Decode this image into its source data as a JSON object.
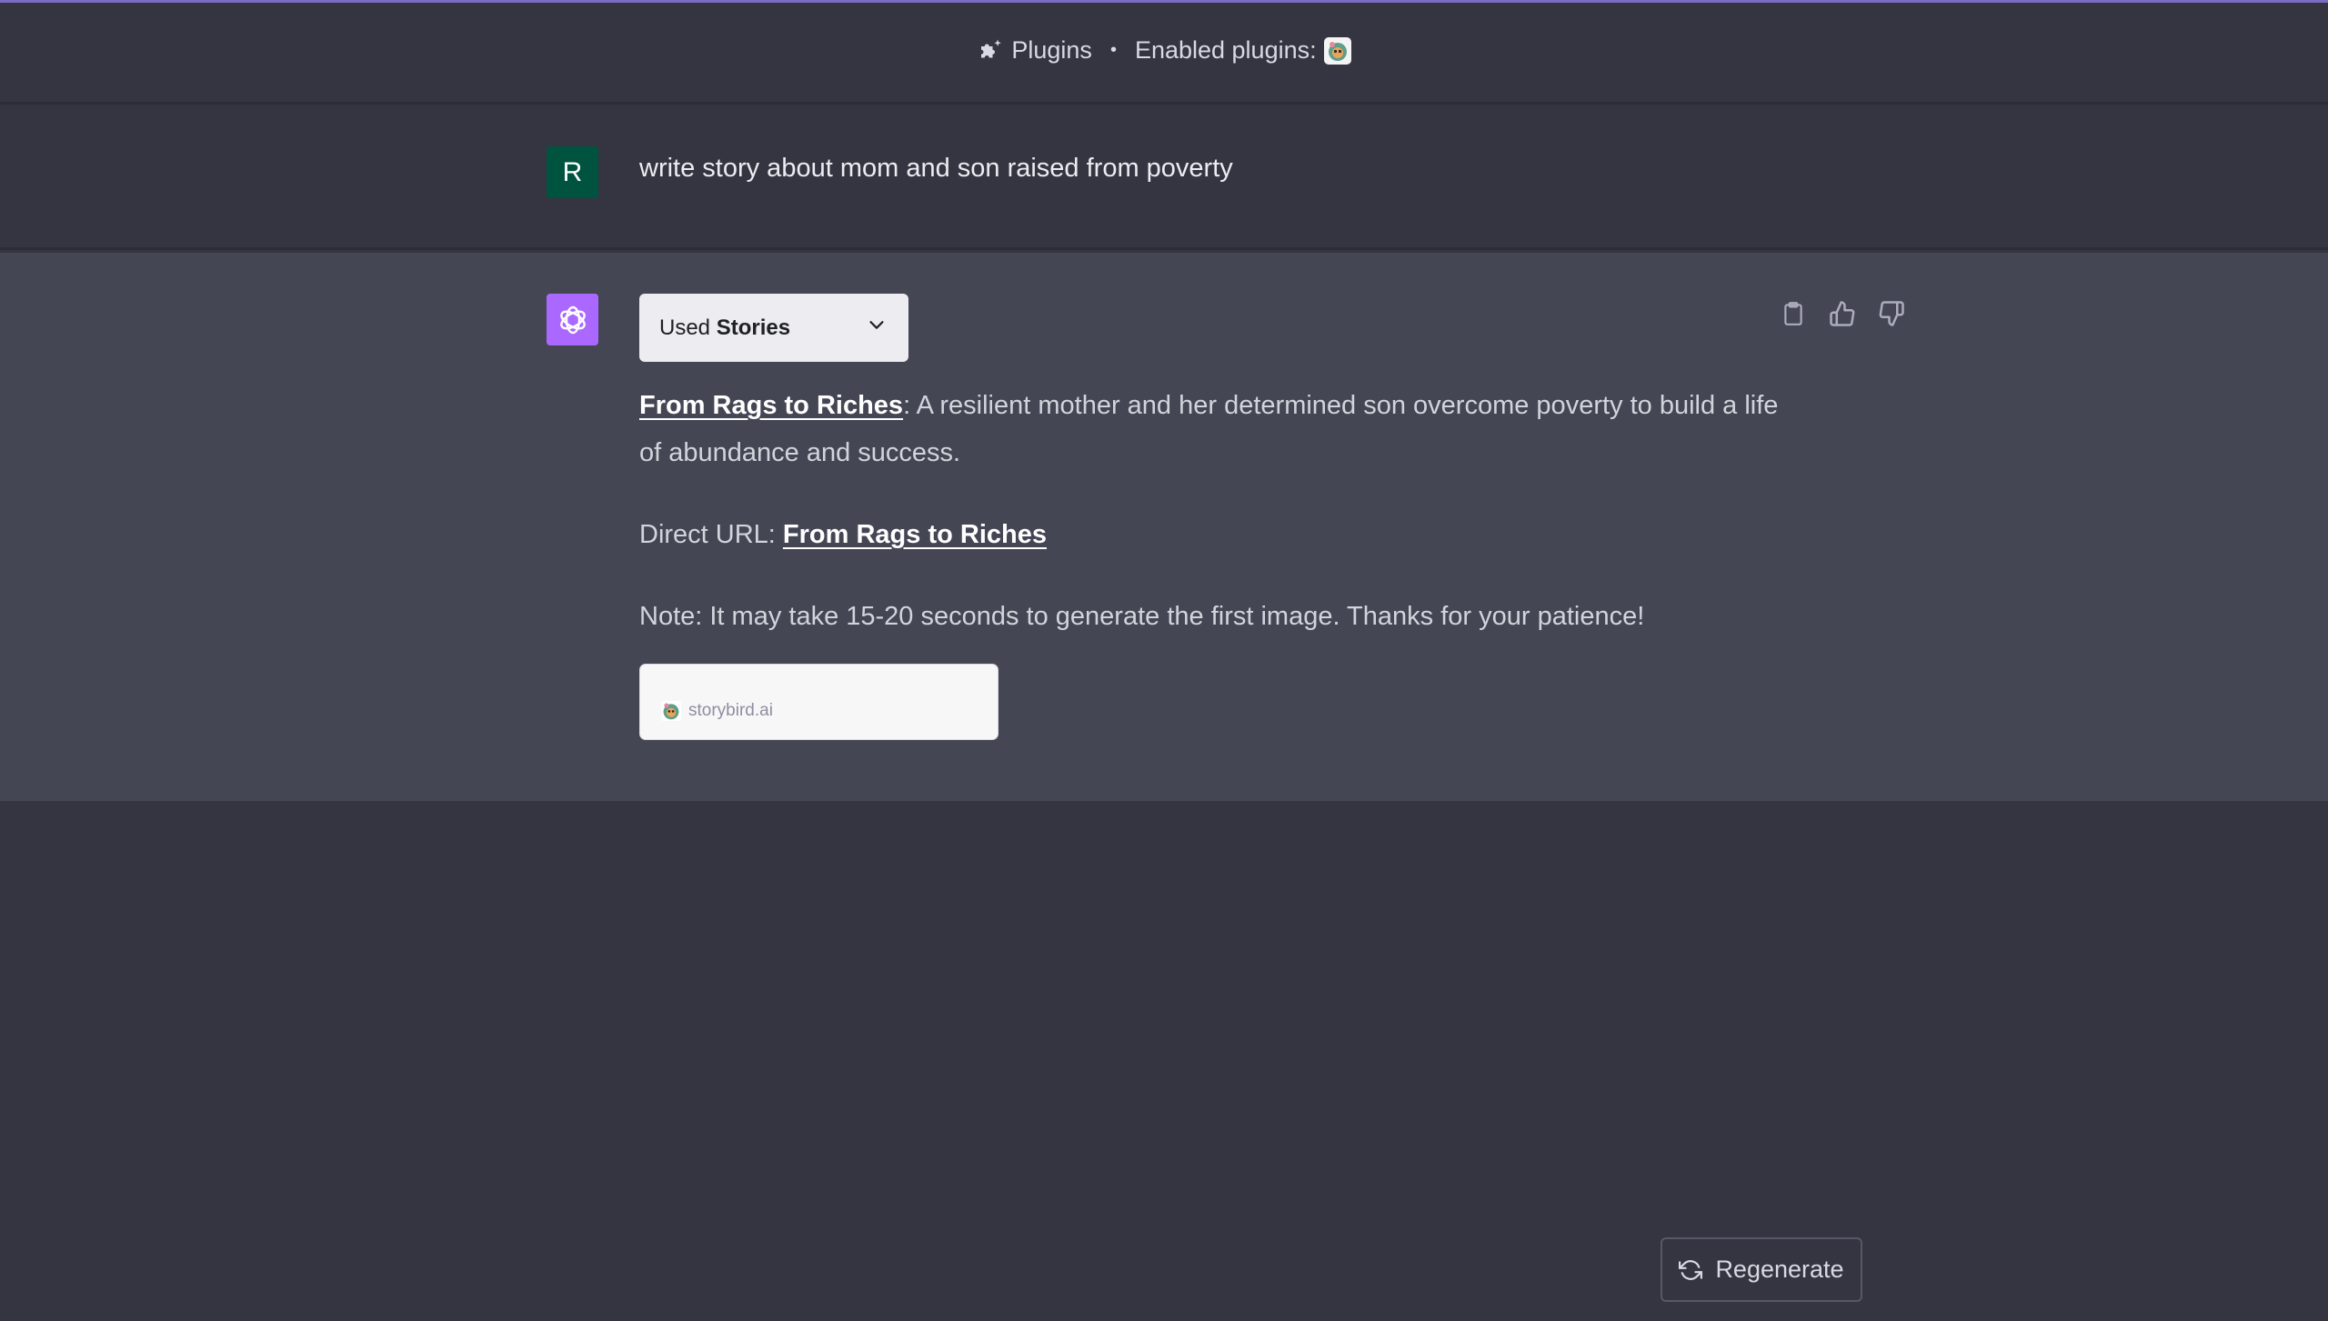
{
  "header": {
    "plugins_label": "Plugins",
    "separator": "•",
    "enabled_label": "Enabled plugins:",
    "enabled_plugins": [
      {
        "name": "Stories",
        "icon": "storybird-owl-icon"
      }
    ]
  },
  "conversation": {
    "user_message": {
      "avatar_letter": "R",
      "avatar_color": "#00543f",
      "text": "write story about mom and son raised from poverty"
    },
    "assistant_message": {
      "avatar_color": "#ab68ff",
      "plugin_used": {
        "prefix": "Used",
        "name": "Stories"
      },
      "actions": [
        {
          "name": "copy",
          "icon": "clipboard-icon"
        },
        {
          "name": "thumbs-up",
          "icon": "thumbs-up-icon"
        },
        {
          "name": "thumbs-down",
          "icon": "thumbs-down-icon"
        }
      ],
      "paragraph1": {
        "link_text": "From Rags to Riches",
        "text": ": A resilient mother and her determined son overcome poverty to build a life of abundance and success."
      },
      "paragraph2": {
        "prefix": "Direct URL: ",
        "link_text": "From Rags to Riches"
      },
      "paragraph3": {
        "text": "Note: It may take 15-20 seconds to generate the first image. Thanks for your patience!"
      },
      "link_card": {
        "domain": "storybird.ai"
      }
    }
  },
  "footer": {
    "regenerate_label": "Regenerate"
  },
  "colors": {
    "background": "#343541",
    "assistant_row": "#444654",
    "accent_top": "#7c6bc4"
  }
}
